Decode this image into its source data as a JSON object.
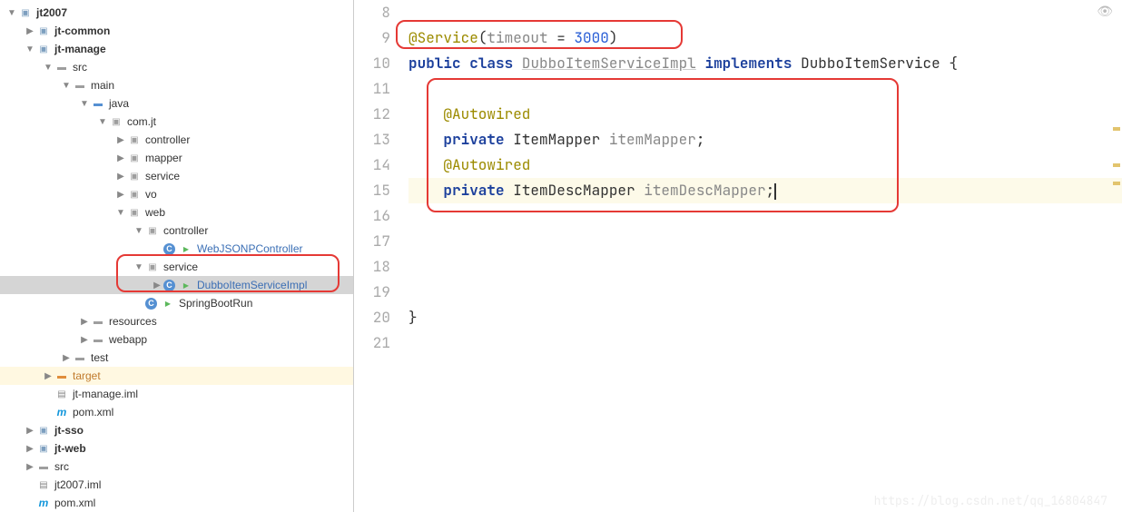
{
  "tree": {
    "root": "jt2007",
    "jt_common": "jt-common",
    "jt_manage": "jt-manage",
    "src": "src",
    "main": "main",
    "java": "java",
    "com_jt": "com.jt",
    "controller": "controller",
    "mapper": "mapper",
    "service": "service",
    "vo": "vo",
    "web": "web",
    "web_controller": "controller",
    "web_jsonp": "WebJSONPController",
    "web_service": "service",
    "dubbo_item": "DubboItemServiceImpl",
    "spring_boot_run": "SpringBootRun",
    "resources": "resources",
    "webapp": "webapp",
    "test": "test",
    "target": "target",
    "jt_manage_iml": "jt-manage.iml",
    "pom_xml": "pom.xml",
    "jt_sso": "jt-sso",
    "jt_web": "jt-web",
    "src2": "src",
    "jt2007_iml": "jt2007.iml",
    "pom_xml2": "pom.xml"
  },
  "gutter": [
    "8",
    "9",
    "10",
    "11",
    "12",
    "13",
    "14",
    "15",
    "16",
    "17",
    "18",
    "19",
    "20",
    "21"
  ],
  "code": {
    "service_ann": "@Service",
    "timeout_key": "timeout",
    "timeout_val": "3000",
    "public": "public",
    "class_kw": "class",
    "class_name": "DubboItemServiceImpl",
    "implements": "implements",
    "interface": "DubboItemService",
    "autowired1": "@Autowired",
    "private1": "private",
    "type1": "ItemMapper",
    "field1": "itemMapper",
    "autowired2": "@Autowired",
    "private2": "private",
    "type2": "ItemDescMapper",
    "field2": "itemDescMapper"
  },
  "watermark": "https://blog.csdn.net/qq_16804847"
}
